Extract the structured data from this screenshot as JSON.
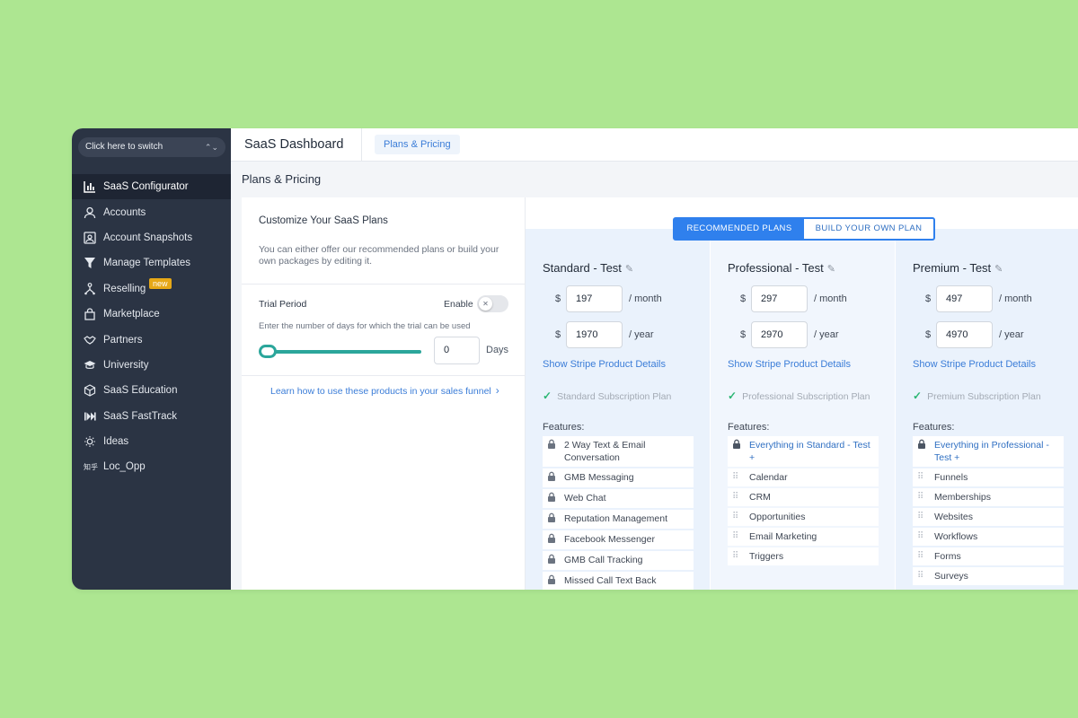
{
  "sidebar": {
    "switcher": "Click here to switch",
    "items": [
      {
        "label": "SaaS Configurator",
        "icon": "chart-bar-icon",
        "active": true
      },
      {
        "label": "Accounts",
        "icon": "user-icon"
      },
      {
        "label": "Account Snapshots",
        "icon": "snapshot-icon"
      },
      {
        "label": "Manage Templates",
        "icon": "filter-icon"
      },
      {
        "label": "Reselling",
        "icon": "network-icon",
        "badge": "new"
      },
      {
        "label": "Marketplace",
        "icon": "shopping-bag-icon"
      },
      {
        "label": "Partners",
        "icon": "handshake-icon"
      },
      {
        "label": "University",
        "icon": "graduation-cap-icon"
      },
      {
        "label": "SaaS Education",
        "icon": "box-icon"
      },
      {
        "label": "SaaS FastTrack",
        "icon": "fast-forward-icon"
      },
      {
        "label": "Ideas",
        "icon": "lightbulb-icon"
      },
      {
        "label": "Loc_Opp",
        "icon": "zhihu-icon",
        "icon_text": "知乎"
      }
    ]
  },
  "header": {
    "title": "SaaS Dashboard",
    "tab": "Plans & Pricing"
  },
  "page": {
    "title": "Plans & Pricing",
    "customize_title": "Customize Your SaaS Plans",
    "customize_desc": "You can either offer our recommended plans or build your own packages by editing it.",
    "trial_label": "Trial Period",
    "enable_label": "Enable",
    "trial_hint": "Enter the number of days for which the trial can be used",
    "trial_days": "0",
    "days_label": "Days",
    "learn_link": "Learn how to use these products in your sales funnel"
  },
  "plan_toggle": {
    "recommended": "RECOMMENDED PLANS",
    "build": "BUILD YOUR OWN PLAN"
  },
  "plans": [
    {
      "name": "Standard - Test",
      "currency": "$",
      "monthly": "197",
      "yearly": "1970",
      "per_month": "/ month",
      "per_year": "/ year",
      "stripe_link": "Show Stripe Product Details",
      "subscription": "Standard Subscription Plan",
      "features_label": "Features:",
      "features": [
        "2 Way Text & Email Conversation",
        "GMB Messaging",
        "Web Chat",
        "Reputation Management",
        "Facebook Messenger",
        "GMB Call Tracking",
        "Missed Call Text Back"
      ]
    },
    {
      "name": "Professional - Test",
      "currency": "$",
      "monthly": "297",
      "yearly": "2970",
      "per_month": "/ month",
      "per_year": "/ year",
      "stripe_link": "Show Stripe Product Details",
      "subscription": "Professional Subscription Plan",
      "features_label": "Features:",
      "features": [
        "Everything in Standard - Test +",
        "Calendar",
        "CRM",
        "Opportunities",
        "Email Marketing",
        "Triggers"
      ]
    },
    {
      "name": "Premium - Test",
      "currency": "$",
      "monthly": "497",
      "yearly": "4970",
      "per_month": "/ month",
      "per_year": "/ year",
      "stripe_link": "Show Stripe Product Details",
      "subscription": "Premium Subscription Plan",
      "features_label": "Features:",
      "features": [
        "Everything in Professional - Test +",
        "Funnels",
        "Memberships",
        "Websites",
        "Workflows",
        "Forms",
        "Surveys"
      ]
    }
  ],
  "colors": {
    "background": "#ade691",
    "sidebar": "#2b3444",
    "accent": "#2f80ed",
    "slider": "#2ba69b",
    "check": "#2bb673",
    "badge": "#e6a817"
  }
}
